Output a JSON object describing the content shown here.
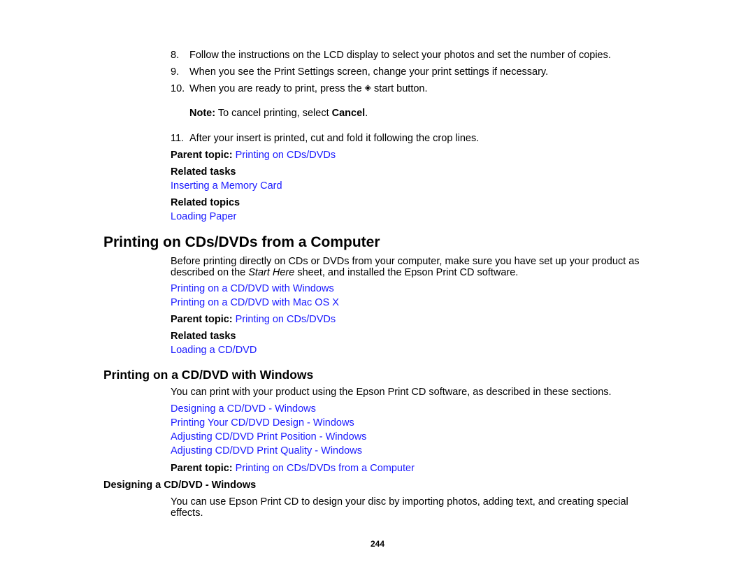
{
  "steps": [
    {
      "number": "8.",
      "text": "Follow the instructions on the LCD display to select your photos and set the number of copies."
    },
    {
      "number": "9.",
      "text": "When you see the Print Settings screen, change your print settings if necessary."
    },
    {
      "number": "10.",
      "text_before": "When you are ready to print, press the",
      "icon": "start-icon",
      "icon_glyph": "◈",
      "text_after": "start button."
    }
  ],
  "note": {
    "label": "Note:",
    "text": " To cancel printing, select ",
    "emphasis": "Cancel",
    "end": "."
  },
  "step11": {
    "number": "11.",
    "text": "After your insert is printed, cut and fold it following the crop lines."
  },
  "section1": {
    "parent_label": "Parent topic:",
    "parent_link": "Printing on CDs/DVDs",
    "related_tasks_label": "Related tasks",
    "related_tasks_link": "Inserting a Memory Card",
    "related_topics_label": "Related topics",
    "related_topics_link": "Loading Paper"
  },
  "section2": {
    "title": "Printing on CDs/DVDs from a Computer",
    "intro_before": "Before printing directly on CDs or DVDs from your computer, make sure you have set up your product as described on the ",
    "intro_italic": "Start Here",
    "intro_after": " sheet, and installed the Epson Print CD software.",
    "links": [
      "Printing on a CD/DVD with Windows",
      "Printing on a CD/DVD with Mac OS X"
    ],
    "parent_label": "Parent topic:",
    "parent_link": "Printing on CDs/DVDs",
    "related_tasks_label": "Related tasks",
    "related_tasks_link": "Loading a CD/DVD"
  },
  "section3": {
    "title": "Printing on a CD/DVD with Windows",
    "intro": "You can print with your product using the Epson Print CD software, as described in these sections.",
    "links": [
      "Designing a CD/DVD - Windows",
      "Printing Your CD/DVD Design - Windows",
      "Adjusting CD/DVD Print Position - Windows",
      "Adjusting CD/DVD Print Quality - Windows"
    ],
    "parent_label": "Parent topic:",
    "parent_link": "Printing on CDs/DVDs from a Computer"
  },
  "section4": {
    "title": "Designing a CD/DVD - Windows",
    "text": "You can use Epson Print CD to design your disc by importing photos, adding text, and creating special effects."
  },
  "page_number": "244",
  "colors": {
    "link": "#1a1aff",
    "text": "#000000"
  }
}
